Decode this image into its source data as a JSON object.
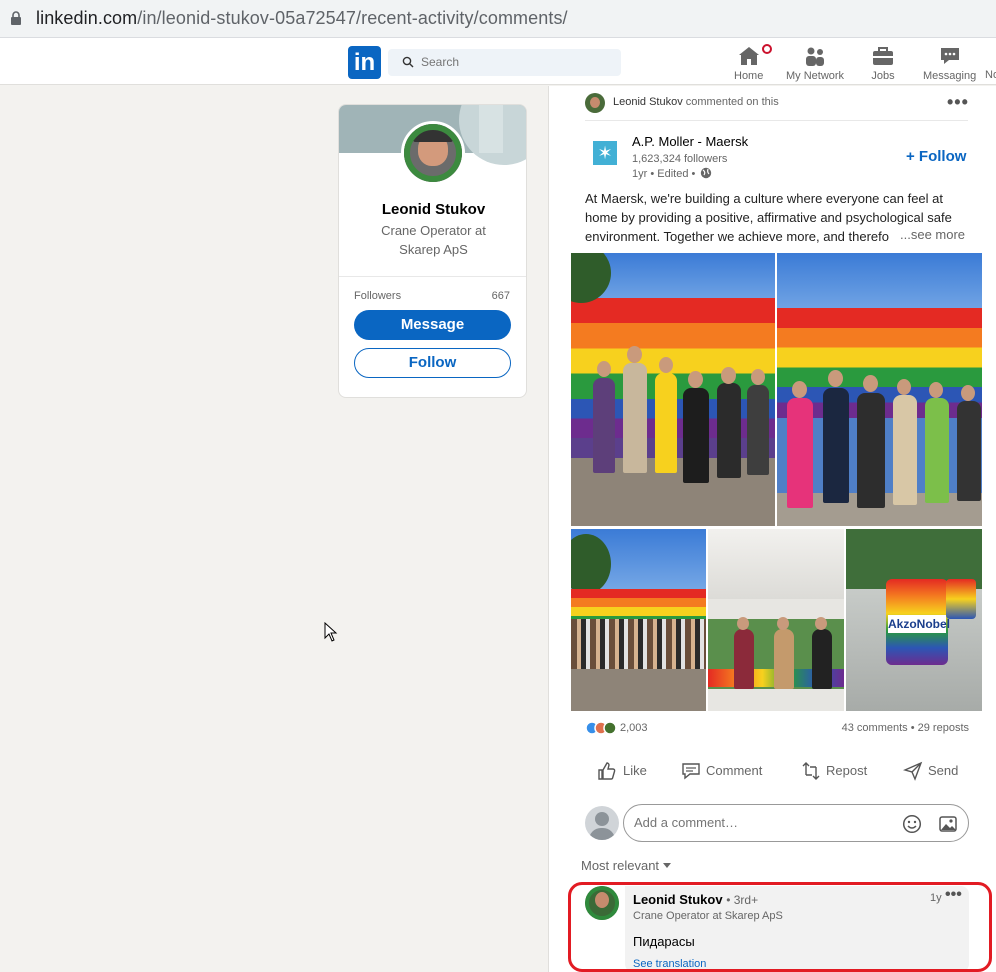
{
  "browser": {
    "url_host": "linkedin.com",
    "url_path": "/in/leonid-stukov-05a72547/recent-activity/comments/"
  },
  "nav": {
    "logo": "in",
    "search_placeholder": "Search",
    "items": [
      {
        "label": "Home",
        "icon": "home-icon"
      },
      {
        "label": "My Network",
        "icon": "network-icon"
      },
      {
        "label": "Jobs",
        "icon": "briefcase-icon"
      },
      {
        "label": "Messaging",
        "icon": "messaging-icon"
      },
      {
        "label": "No"
      }
    ]
  },
  "profile_card": {
    "name": "Leonid Stukov",
    "headline": "Crane Operator at Skarep ApS",
    "followers_label": "Followers",
    "followers_count": "667",
    "message_label": "Message",
    "follow_label": "Follow"
  },
  "post": {
    "context_name": "Leonid Stukov",
    "context_action": "commented on this",
    "company_name": "A.P. Moller - Maersk",
    "company_followers": "1,623,324 followers",
    "company_time": "1yr • Edited •",
    "follow_label": "+ Follow",
    "text": "At Maersk, we're building a culture where everyone can feel at home by providing a positive, affirmative and psychological safe environment. Together we achieve more, and therefo",
    "see_more": "...see more",
    "reactions_count": "2,003",
    "comments_reposts": "43 comments • 29 reposts",
    "actions": {
      "like": "Like",
      "comment": "Comment",
      "repost": "Repost",
      "send": "Send"
    },
    "comment_placeholder": "Add a comment…",
    "sort_label": "Most relevant",
    "image_logo_text": "AkzoNobel"
  },
  "comment": {
    "name": "Leonid Stukov",
    "degree": "• 3rd+",
    "headline": "Crane Operator at Skarep ApS",
    "time": "1y",
    "text": "Пидарасы",
    "see_translation": "See translation"
  },
  "colors": {
    "brand": "#0a66c2",
    "highlight": "#e21b23",
    "background": "#f3f2ef"
  }
}
